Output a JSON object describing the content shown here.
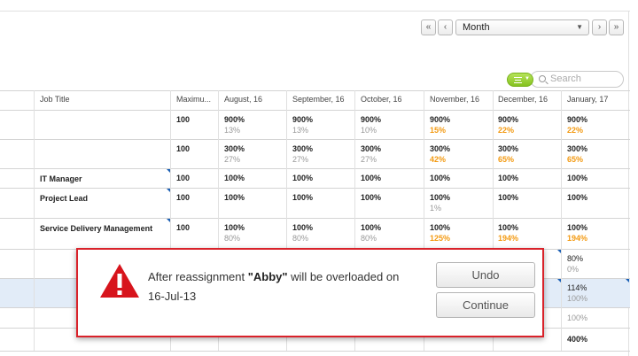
{
  "toolbar": {
    "first_glyph": "«",
    "prev_glyph": "‹",
    "next_glyph": "›",
    "last_glyph": "»",
    "period_value": "Month",
    "caret_glyph": "▼",
    "filter_drop_glyph": "▼",
    "search_placeholder": "Search"
  },
  "table": {
    "columns": [
      "Job Title",
      "Maximu...",
      "August, 16",
      "September, 16",
      "October, 16",
      "November, 16",
      "December, 16",
      "January, 17"
    ],
    "rows": [
      {
        "title": "",
        "max": "100",
        "values": [
          [
            "900%",
            "13%"
          ],
          [
            "900%",
            "13%"
          ],
          [
            "900%",
            "10%"
          ],
          [
            "900%",
            "15%"
          ],
          [
            "900%",
            "22%"
          ],
          [
            "900%",
            "22%"
          ]
        ]
      },
      {
        "title": "",
        "max": "100",
        "values": [
          [
            "300%",
            "27%"
          ],
          [
            "300%",
            "27%"
          ],
          [
            "300%",
            "27%"
          ],
          [
            "300%",
            "42%"
          ],
          [
            "300%",
            "65%"
          ],
          [
            "300%",
            "65%"
          ]
        ]
      },
      {
        "title": "IT Manager",
        "max": "100",
        "values": [
          [
            "100%",
            ""
          ],
          [
            "100%",
            ""
          ],
          [
            "100%",
            ""
          ],
          [
            "100%",
            ""
          ],
          [
            "100%",
            ""
          ],
          [
            "100%",
            ""
          ]
        ]
      },
      {
        "title": "Project Lead",
        "max": "100",
        "values": [
          [
            "100%",
            ""
          ],
          [
            "100%",
            ""
          ],
          [
            "100%",
            ""
          ],
          [
            "100%",
            "1%"
          ],
          [
            "100%",
            ""
          ],
          [
            "100%",
            ""
          ]
        ]
      },
      {
        "title": "Service Delivery Management",
        "max": "100",
        "values": [
          [
            "100%",
            "80%"
          ],
          [
            "100%",
            "80%"
          ],
          [
            "100%",
            "80%"
          ],
          [
            "100%",
            "125%"
          ],
          [
            "100%",
            "194%"
          ],
          [
            "100%",
            "194%"
          ]
        ]
      }
    ],
    "partial_rows": [
      {
        "main": "80%",
        "sub": "0%"
      },
      {
        "main": "114%",
        "sub": "100%"
      },
      {
        "main": "",
        "sub": "100%"
      },
      {
        "main": "400%",
        "sub": ""
      }
    ]
  },
  "dialog": {
    "message_prefix": "After reassignment ",
    "message_name": "\"Abby\"",
    "message_suffix": " will be overloaded on",
    "message_date": "16-Jul-13",
    "undo_label": "Undo",
    "continue_label": "Continue"
  },
  "colors": {
    "overload": "#f39a12",
    "dialog_border": "#d9222a",
    "warning_icon": "#d7141c",
    "filter_green": "#85c21f",
    "selection": "#e2ecf8"
  }
}
